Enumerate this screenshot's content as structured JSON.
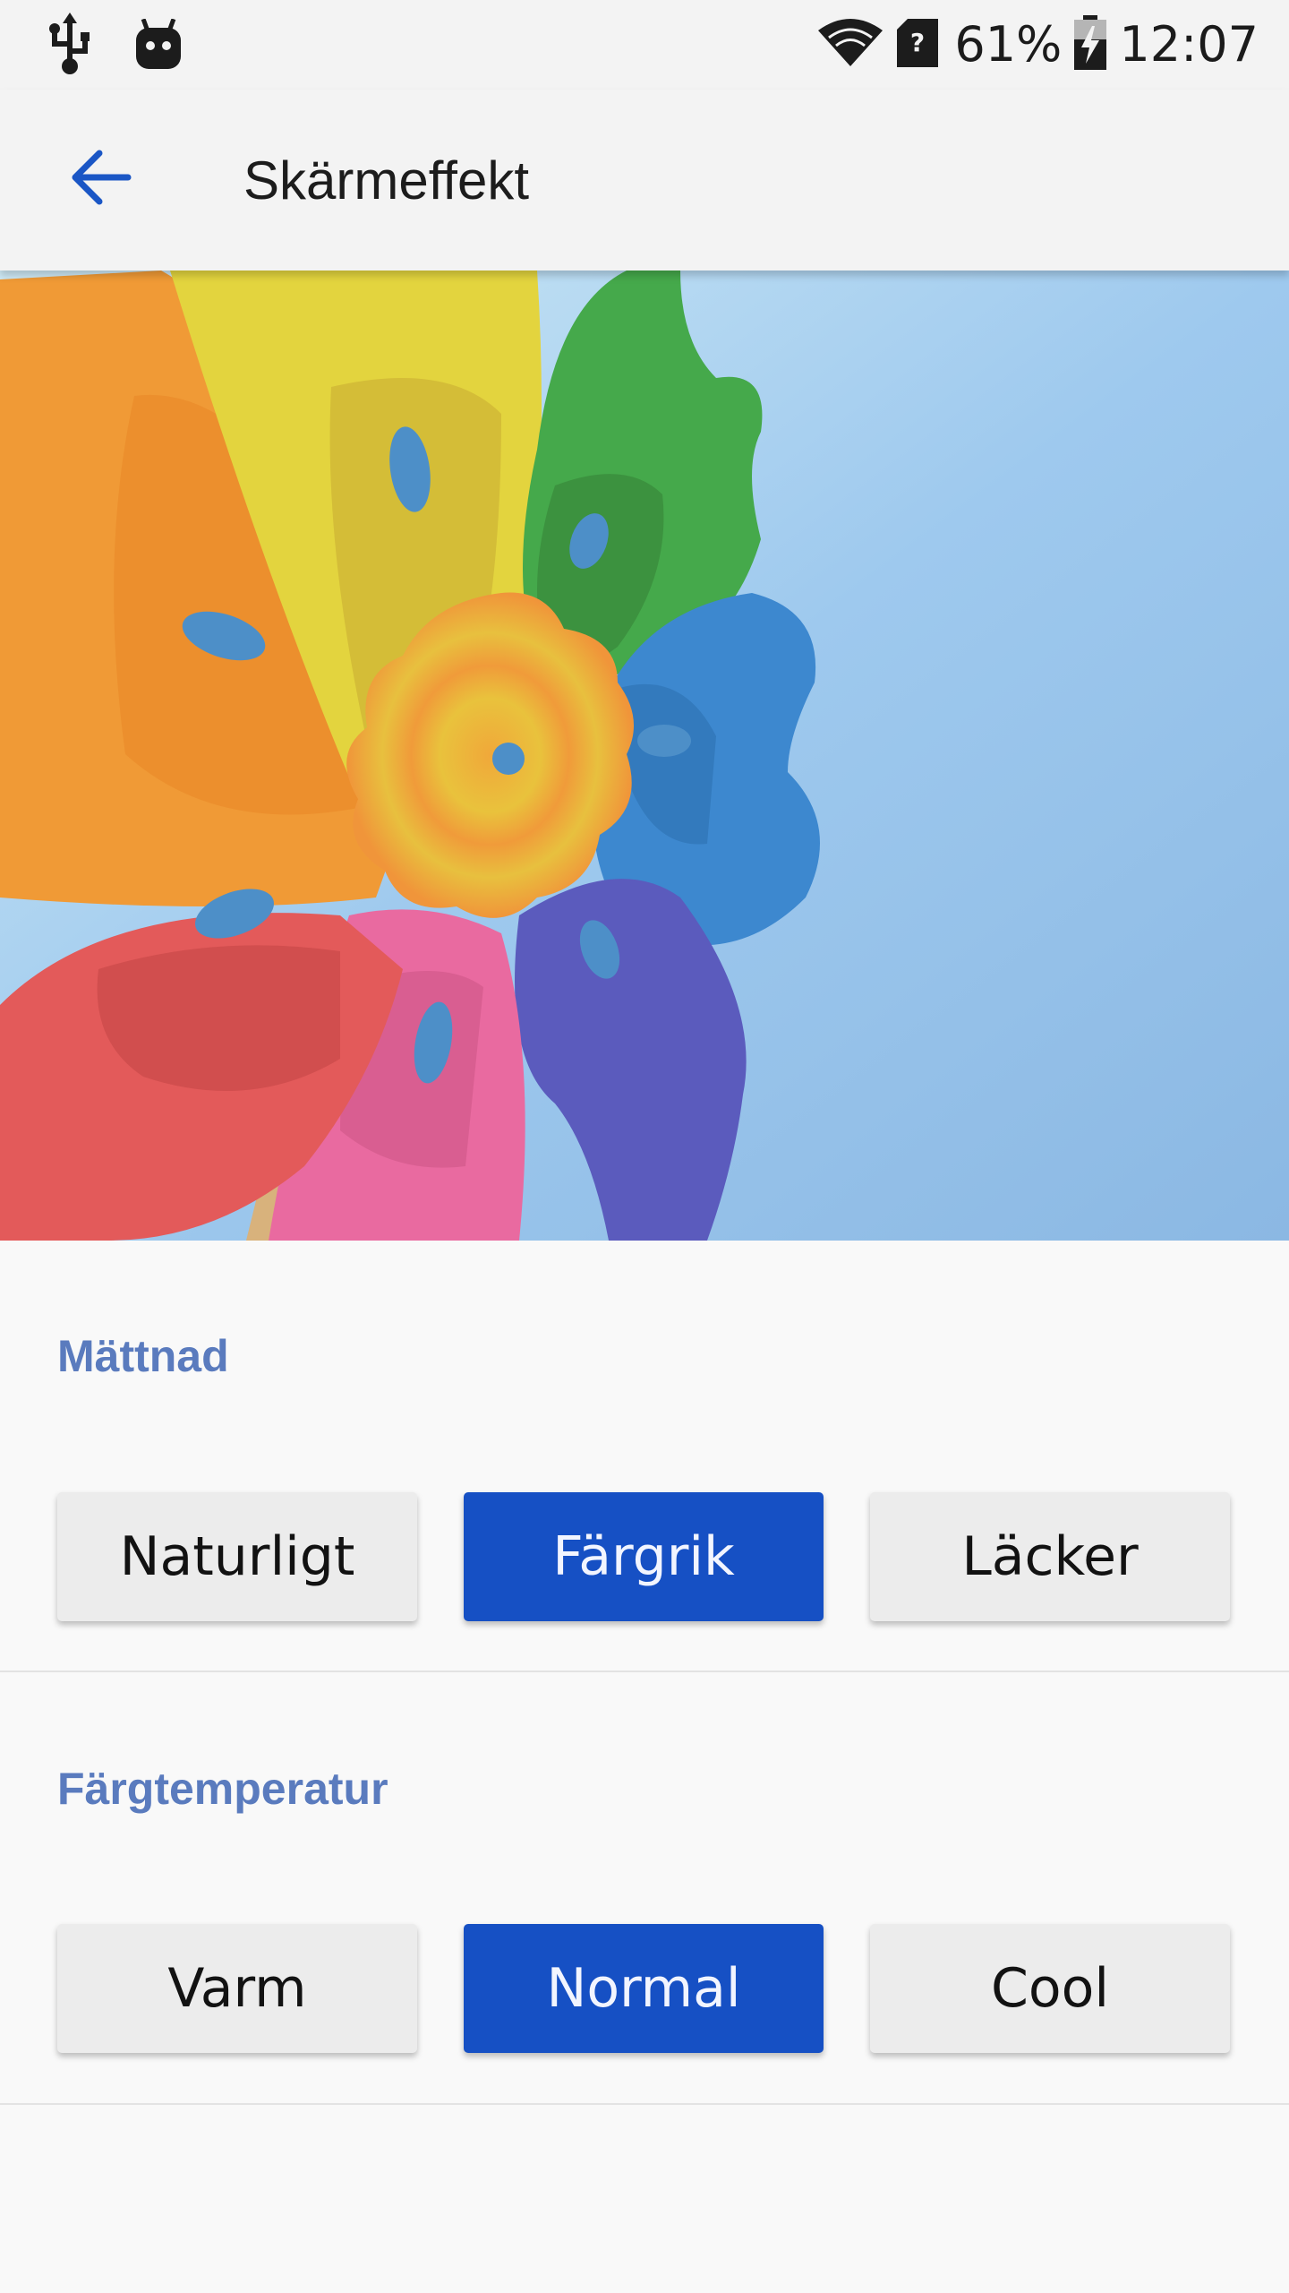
{
  "status_bar": {
    "battery": "61%",
    "time": "12:07",
    "icons": [
      "usb-icon",
      "android-debug-icon",
      "wifi-icon",
      "sim-unknown-icon",
      "battery-charging-icon"
    ]
  },
  "app_bar": {
    "title": "Skärmeffekt",
    "back_icon": "arrow-back-icon"
  },
  "colors": {
    "accent": "#1650c4",
    "section_title": "#5a7bbe",
    "button_bg": "#ececec",
    "page_bg": "#f9f9f9"
  },
  "saturation": {
    "title": "Mättnad",
    "options": [
      {
        "label": "Naturligt",
        "selected": false
      },
      {
        "label": "Färgrik",
        "selected": true
      },
      {
        "label": "Läcker",
        "selected": false
      }
    ]
  },
  "temperature": {
    "title": "Färgtemperatur",
    "options": [
      {
        "label": "Varm",
        "selected": false
      },
      {
        "label": "Normal",
        "selected": true
      },
      {
        "label": "Cool",
        "selected": false
      }
    ]
  }
}
